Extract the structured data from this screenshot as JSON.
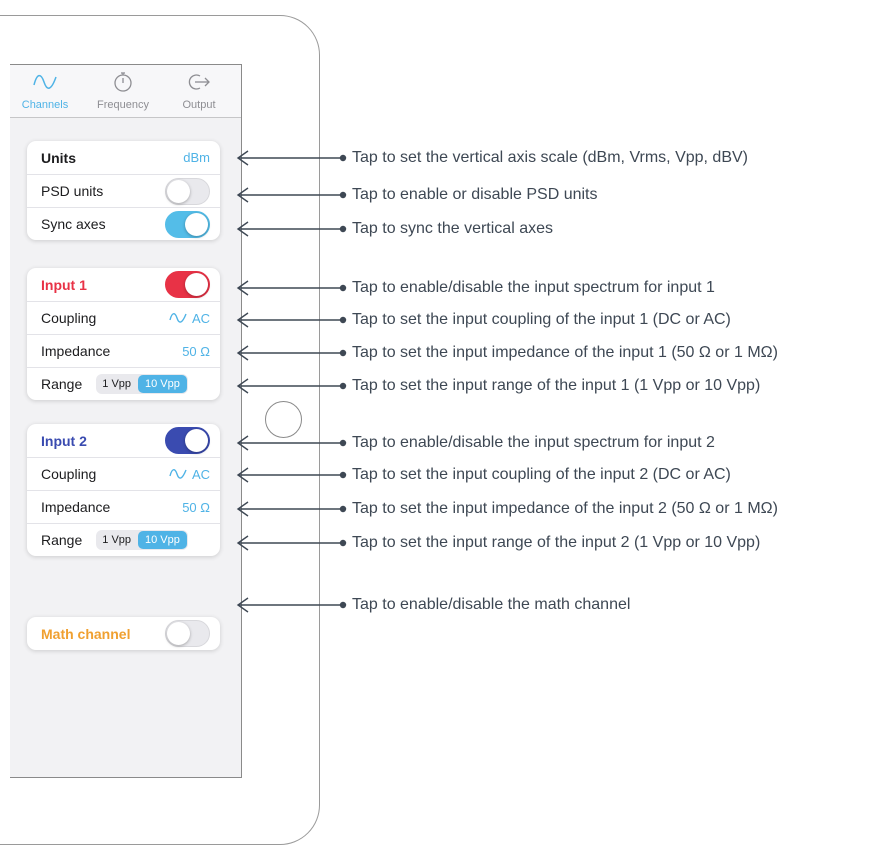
{
  "tabs": [
    {
      "label": "Channels",
      "icon": "waveform-icon",
      "active": true
    },
    {
      "label": "Frequency",
      "icon": "stopwatch-icon",
      "active": false
    },
    {
      "label": "Output",
      "icon": "output-icon",
      "active": false
    }
  ],
  "general": {
    "units_label": "Units",
    "units_value": "dBm",
    "psd_label": "PSD units",
    "sync_label": "Sync axes"
  },
  "input1": {
    "title": "Input 1",
    "coupling_label": "Coupling",
    "coupling_value": "AC",
    "impedance_label": "Impedance",
    "impedance_value": "50 Ω",
    "range_label": "Range",
    "range_options": [
      "1 Vpp",
      "10 Vpp"
    ],
    "range_selected": "10 Vpp",
    "enabled": true
  },
  "input2": {
    "title": "Input 2",
    "coupling_label": "Coupling",
    "coupling_value": "AC",
    "impedance_label": "Impedance",
    "impedance_value": "50 Ω",
    "range_label": "Range",
    "range_options": [
      "1 Vpp",
      "10 Vpp"
    ],
    "range_selected": "10 Vpp",
    "enabled": true
  },
  "math": {
    "title": "Math channel",
    "enabled": false
  },
  "toggles": {
    "psd_units": false,
    "sync_axes": true
  },
  "colors": {
    "accent": "#4fb3e6",
    "input1": "#e83246",
    "input2": "#3a4bb0",
    "math": "#f0a030"
  },
  "annotations": [
    "Tap to set the vertical axis scale (dBm, Vrms, Vpp, dBV)",
    "Tap to enable or disable PSD units",
    "Tap to sync the vertical axes",
    "Tap to enable/disable the input spectrum for input 1",
    "Tap to set the input coupling of the input 1 (DC or AC)",
    "Tap to set the input impedance of the input 1 (50 Ω or 1 MΩ)",
    "Tap to set the input range of the input 1 (1 Vpp or 10 Vpp)",
    "Tap to enable/disable the input spectrum for input 2",
    "Tap to set the input coupling of the input 2 (DC or AC)",
    "Tap to set the input impedance of the input 2 (50 Ω or 1 MΩ)",
    "Tap to set the input range of the input 2 (1 Vpp or 10 Vpp)",
    "Tap to enable/disable the math channel"
  ]
}
